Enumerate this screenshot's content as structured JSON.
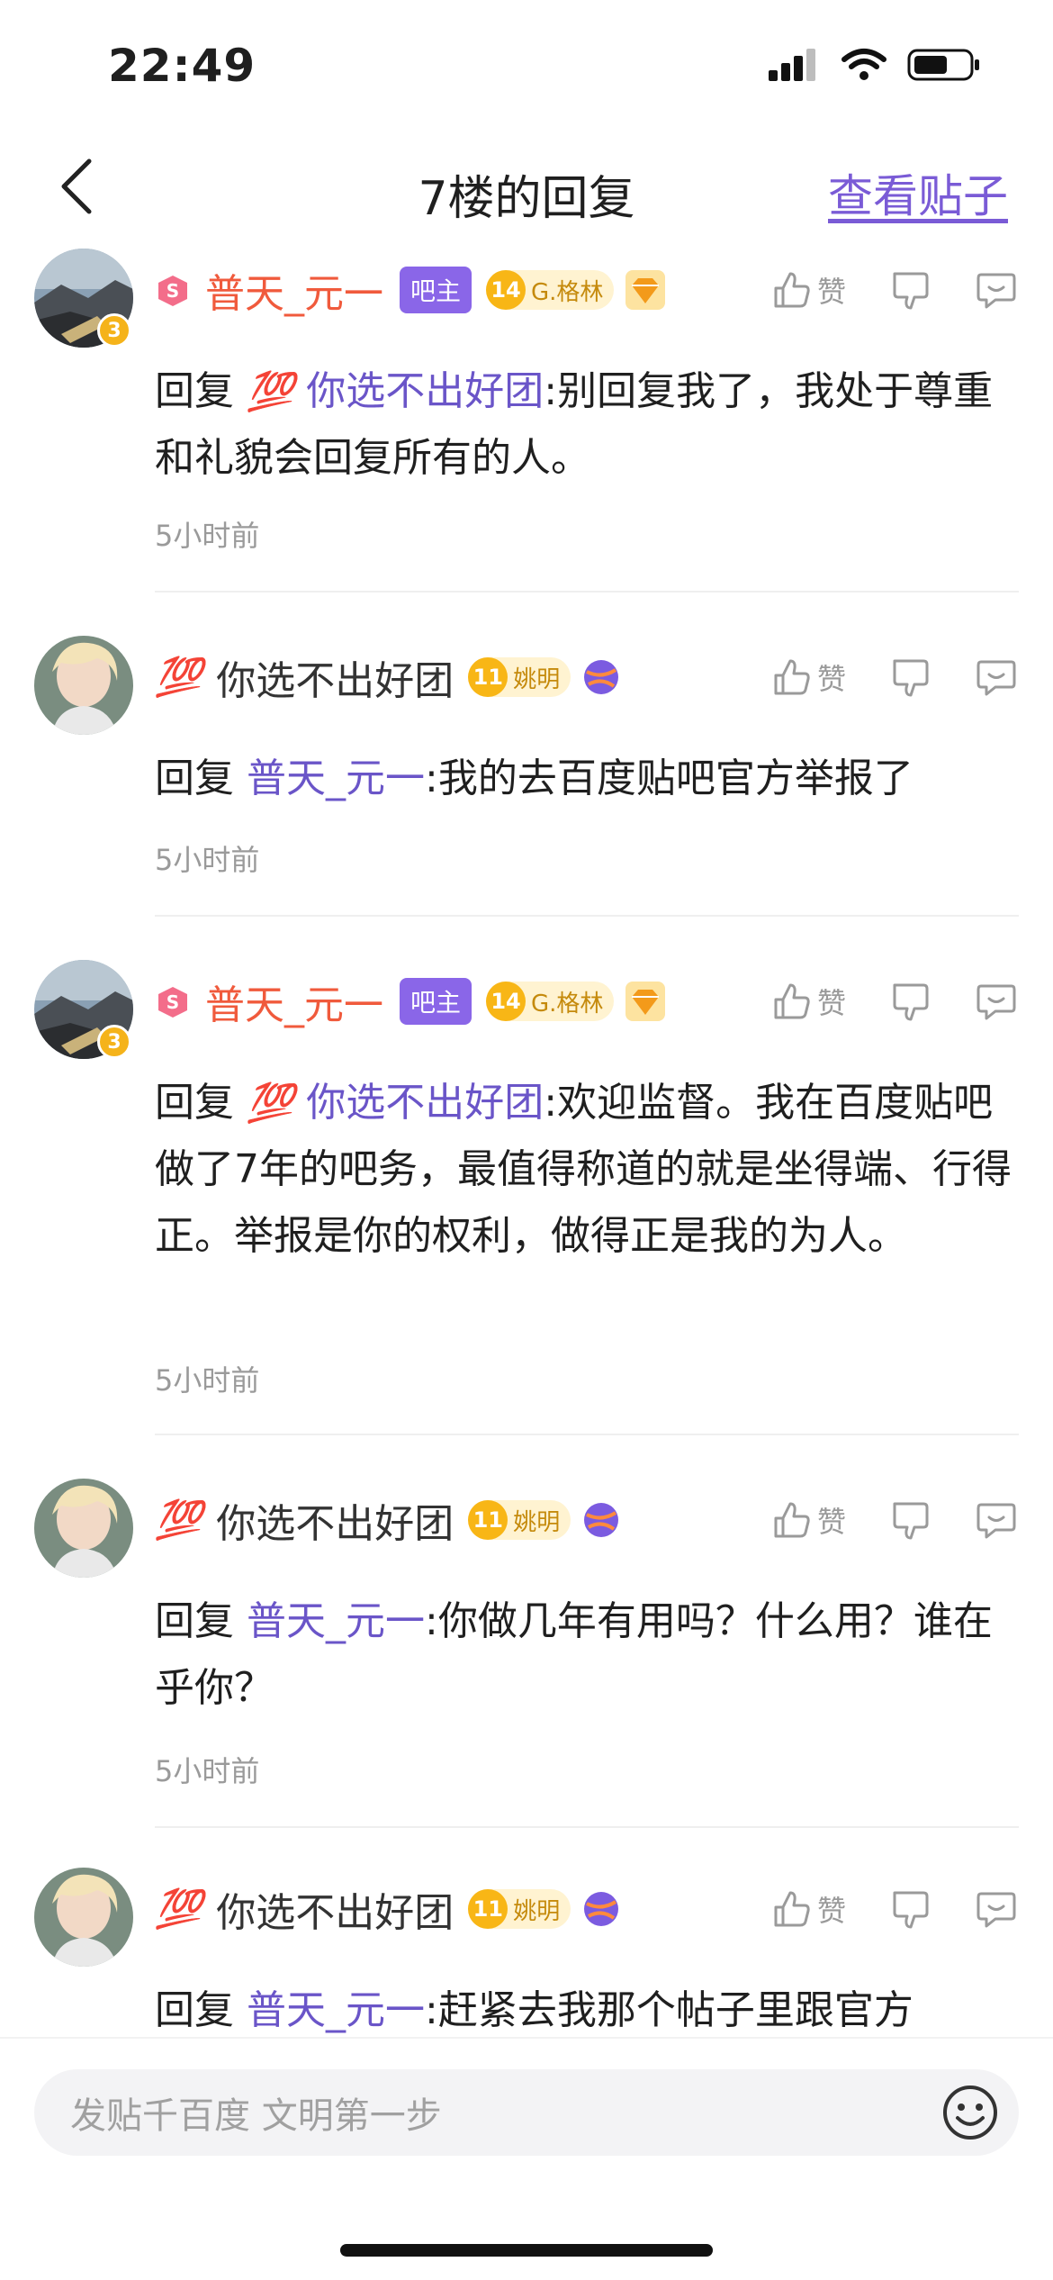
{
  "status_bar": {
    "time": "22:49"
  },
  "nav": {
    "title": "7楼的回复",
    "view_post": "查看贴子"
  },
  "comments": [
    {
      "user": "普天_元一",
      "role_badge": "吧主",
      "level": "14",
      "level_title": "G.格林",
      "reply_prefix": "回复",
      "emoji": "💯",
      "mention": "你选不出好团",
      "text": ":别回复我了，我处于尊重和礼貌会回复所有的人。",
      "time": "5小时前",
      "like_label": "赞",
      "avatar_level": "3"
    },
    {
      "user_emoji": "💯",
      "user": "你选不出好团",
      "level": "11",
      "level_title": "姚明",
      "reply_prefix": "回复",
      "mention": "普天_元一",
      "text": ":我的去百度贴吧官方举报了",
      "time": "5小时前",
      "like_label": "赞"
    },
    {
      "user": "普天_元一",
      "role_badge": "吧主",
      "level": "14",
      "level_title": "G.格林",
      "reply_prefix": "回复",
      "emoji": "💯",
      "mention": "你选不出好团",
      "text": ":欢迎监督。我在百度贴吧做了7年的吧务，最值得称道的就是坐得端、行得正。举报是你的权利，做得正是我的为人。",
      "time": "5小时前",
      "like_label": "赞",
      "avatar_level": "3"
    },
    {
      "user_emoji": "💯",
      "user": "你选不出好团",
      "level": "11",
      "level_title": "姚明",
      "reply_prefix": "回复",
      "mention": "普天_元一",
      "text": ":你做几年有用吗？什么用？谁在乎你？",
      "time": "5小时前",
      "like_label": "赞"
    },
    {
      "user_emoji": "💯",
      "user": "你选不出好团",
      "level": "11",
      "level_title": "姚明",
      "reply_prefix": "回复",
      "mention": "普天_元一",
      "text": ":赶紧去我那个帖子里跟官方",
      "like_label": "赞"
    }
  ],
  "input": {
    "placeholder": "发贴千百度 文明第一步"
  },
  "colors": {
    "accent": "#7a5bd6",
    "owner_name": "#f05a3c",
    "mention": "#6a55c8",
    "level_gold": "#f8b616"
  }
}
